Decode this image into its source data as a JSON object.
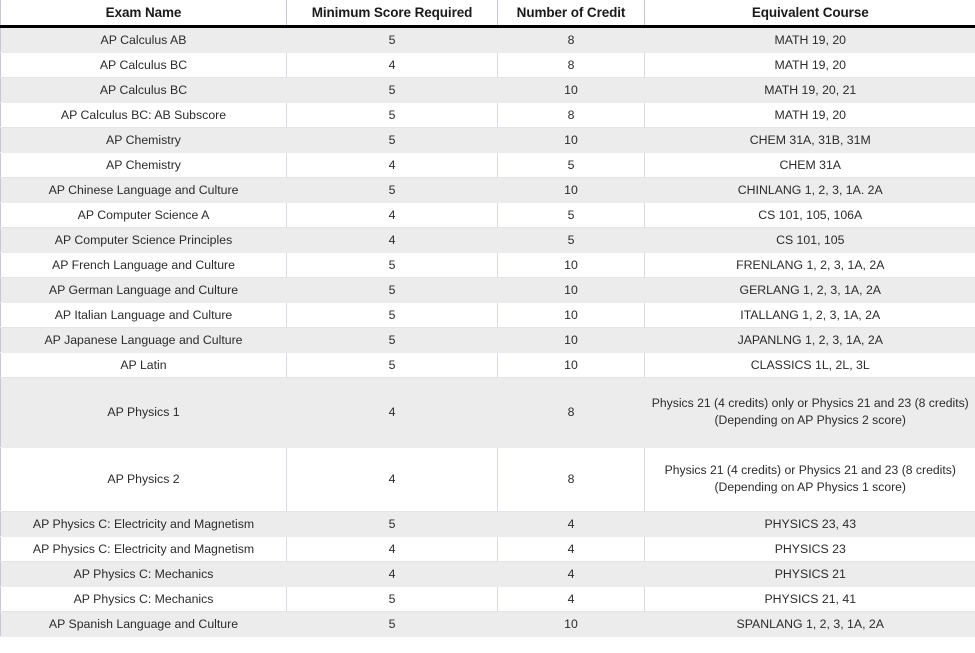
{
  "table": {
    "name": "ap-credit-table",
    "columns": [
      {
        "key": "exam",
        "label": "Exam Name"
      },
      {
        "key": "score",
        "label": "Minimum Score Required"
      },
      {
        "key": "credit",
        "label": "Number of Credit"
      },
      {
        "key": "course",
        "label": "Equivalent Course"
      }
    ],
    "colors": {
      "header_text": "#1a1a1a",
      "header_rule": "#000000",
      "row_alt_background": "#ececec",
      "row_background": "#ffffff",
      "cell_text": "#2b2b2b",
      "grid_line": "#d6dae6"
    },
    "rows": [
      {
        "exam": "AP Calculus AB",
        "score": "5",
        "credit": "8",
        "course": "MATH 19, 20"
      },
      {
        "exam": "AP Calculus BC",
        "score": "4",
        "credit": "8",
        "course": "MATH 19, 20"
      },
      {
        "exam": "AP Calculus BC",
        "score": "5",
        "credit": "10",
        "course": "MATH 19, 20, 21"
      },
      {
        "exam": "AP Calculus BC: AB Subscore",
        "score": "5",
        "credit": "8",
        "course": "MATH 19, 20"
      },
      {
        "exam": "AP Chemistry",
        "score": "5",
        "credit": "10",
        "course": "CHEM 31A, 31B, 31M"
      },
      {
        "exam": "AP Chemistry",
        "score": "4",
        "credit": "5",
        "course": "CHEM 31A"
      },
      {
        "exam": "AP Chinese Language and Culture",
        "score": "5",
        "credit": "10",
        "course": "CHINLANG 1, 2, 3, 1A. 2A"
      },
      {
        "exam": "AP Computer Science A",
        "score": "4",
        "credit": "5",
        "course": "CS 101, 105, 106A"
      },
      {
        "exam": "AP Computer Science Principles",
        "score": "4",
        "credit": "5",
        "course": "CS 101, 105"
      },
      {
        "exam": "AP French Language and Culture",
        "score": "5",
        "credit": "10",
        "course": "FRENLANG 1, 2, 3, 1A, 2A"
      },
      {
        "exam": "AP German Language and Culture",
        "score": "5",
        "credit": "10",
        "course": "GERLANG 1, 2, 3, 1A, 2A"
      },
      {
        "exam": "AP Italian Language and Culture",
        "score": "5",
        "credit": "10",
        "course": "ITALLANG 1, 2, 3, 1A, 2A"
      },
      {
        "exam": "AP Japanese Language and Culture",
        "score": "5",
        "credit": "10",
        "course": "JAPANLNG 1, 2, 3, 1A, 2A"
      },
      {
        "exam": "AP Latin",
        "score": "5",
        "credit": "10",
        "course": "CLASSICS 1L, 2L, 3L"
      },
      {
        "exam": "AP Physics 1",
        "score": "4",
        "credit": "8",
        "course": "Physics 21 (4 credits) only or Physics 21 and 23 (8 credits) (Depending on AP Physics 2 score)",
        "tall": true
      },
      {
        "exam": "AP Physics 2",
        "score": "4",
        "credit": "8",
        "course": "Physics 21 (4 credits) or Physics 21 and 23 (8 credits) (Depending on AP Physics 1 score)",
        "tall": true
      },
      {
        "exam": "AP Physics C: Electricity and Magnetism",
        "score": "5",
        "credit": "4",
        "course": "PHYSICS 23, 43"
      },
      {
        "exam": "AP Physics C: Electricity and Magnetism",
        "score": "4",
        "credit": "4",
        "course": "PHYSICS 23"
      },
      {
        "exam": "AP Physics C: Mechanics",
        "score": "4",
        "credit": "4",
        "course": "PHYSICS 21"
      },
      {
        "exam": "AP Physics C: Mechanics",
        "score": "5",
        "credit": "4",
        "course": "PHYSICS 21, 41"
      },
      {
        "exam": "AP Spanish Language and Culture",
        "score": "5",
        "credit": "10",
        "course": "SPANLANG 1, 2, 3, 1A, 2A"
      }
    ]
  }
}
